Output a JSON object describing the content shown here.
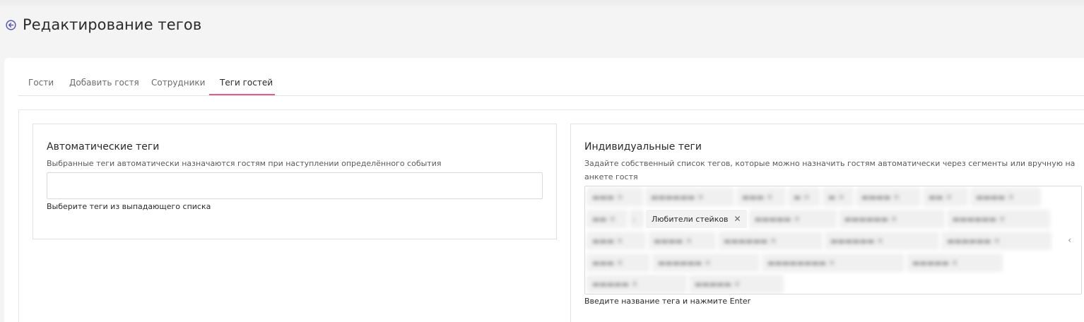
{
  "header": {
    "title": "Редактирование тегов",
    "back_icon": "arrow-left-circle-icon",
    "accent": "#5a58b8"
  },
  "tabs": [
    {
      "label": "Гости",
      "active": false
    },
    {
      "label": "Добавить гостя",
      "active": false
    },
    {
      "label": "Сотрудники",
      "active": false
    },
    {
      "label": "Теги гостей",
      "active": true
    }
  ],
  "tab_accent": "#e05f8e",
  "auto_tags": {
    "title": "Автоматические теги",
    "description": "Выбранные теги автоматически назначаются гостям при наступлении определённого события",
    "input_value": "",
    "hint": "Выберите теги из выпадающего списка"
  },
  "individual_tags": {
    "title": "Индивидуальные теги",
    "description_line1": "Задайте собственный список тегов, которые можно назначить гостям автоматически через сегменты или вручную на",
    "description_line2": "анкете гостя",
    "visible_tag": "Любители стейков",
    "hint": "Введите название тега и нажмите Enter"
  }
}
